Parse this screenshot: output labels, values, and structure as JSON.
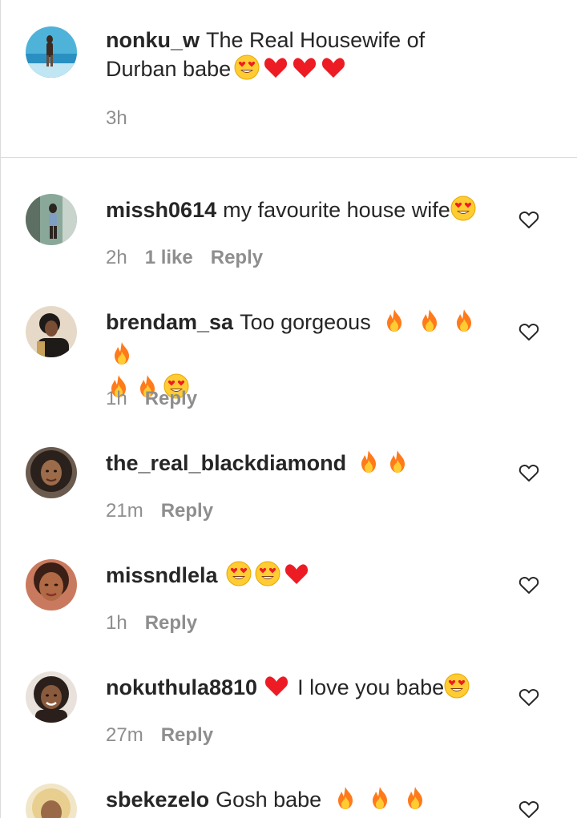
{
  "caption": {
    "username": "nonku_w",
    "text": "The Real Housewife of Durban babe",
    "emojis": [
      "heart-eyes",
      "red-heart",
      "red-heart",
      "red-heart"
    ],
    "time": "3h"
  },
  "comments": [
    {
      "username": "missh0614",
      "text": "my favourite house wife",
      "emojis": [
        "heart-eyes"
      ],
      "time": "2h",
      "likes": "1 like",
      "reply": "Reply"
    },
    {
      "username": "brendam_sa",
      "text": "Too gorgeous",
      "emojis": [
        "fire",
        "fire",
        "fire",
        "fire",
        "fire",
        "fire",
        "heart-eyes"
      ],
      "time": "1h",
      "likes": "",
      "reply": "Reply"
    },
    {
      "username": "the_real_blackdiamond",
      "text": "",
      "emojis": [
        "fire",
        "fire"
      ],
      "time": "21m",
      "likes": "",
      "reply": "Reply"
    },
    {
      "username": "missndlela",
      "text": "",
      "emojis": [
        "heart-eyes",
        "heart-eyes",
        "red-heart"
      ],
      "time": "1h",
      "likes": "",
      "reply": "Reply"
    },
    {
      "username": "nokuthula8810",
      "text": "I love you babe",
      "emojis": [
        "red-heart"
      ],
      "emojis_after": [
        "heart-eyes"
      ],
      "time": "27m",
      "likes": "",
      "reply": "Reply"
    },
    {
      "username": "sbekezelo",
      "text": "Gosh babe",
      "emojis": [
        "fire",
        "fire",
        "fire"
      ],
      "time": "",
      "likes": "",
      "reply": ""
    }
  ],
  "colors": {
    "text": "#262626",
    "secondary": "#8e8e8e",
    "divider": "#dbdbdb",
    "heart": "#ed1c24",
    "emoji_face": "#ffcc33",
    "fire": "#ff9a1f"
  },
  "icons": {
    "like_button": "heart-outline-icon"
  }
}
